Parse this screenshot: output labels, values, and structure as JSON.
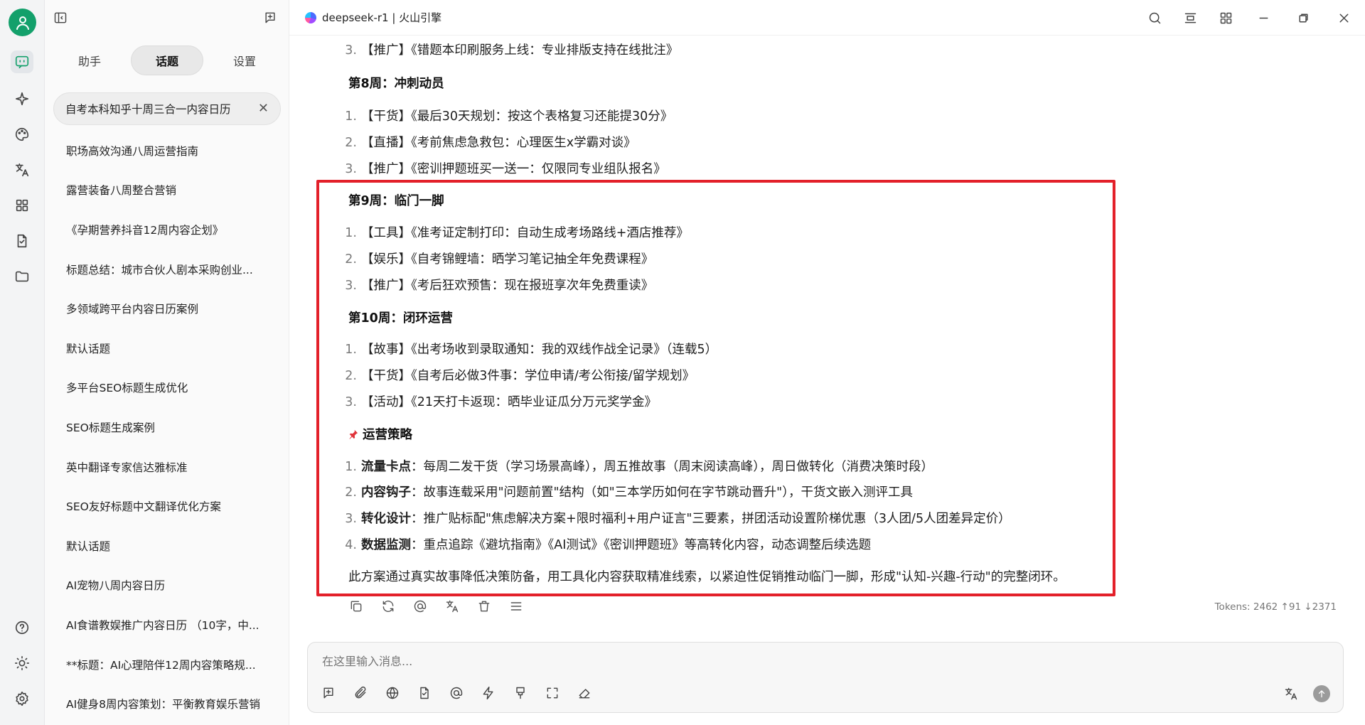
{
  "app": {
    "title": "deepseek-r1 | 火山引擎"
  },
  "panel": {
    "tabs": [
      "助手",
      "话题",
      "设置"
    ],
    "active_tab": 1,
    "topics": [
      "自考本科知乎十周三合一内容日历",
      "职场高效沟通八周运营指南",
      "露营装备八周整合营销",
      "《孕期营养抖音12周内容企划》",
      "标题总结：城市合伙人剧本采购创业...",
      "多领域跨平台内容日历案例",
      "默认话题",
      "多平台SEO标题生成优化",
      "SEO标题生成案例",
      "英中翻译专家信达雅标准",
      "SEO友好标题中文翻译优化方案",
      "默认话题",
      "AI宠物八周内容日历",
      "AI食谱教娱推广内容日历 （10字，中...",
      "**标题：AI心理陪伴12周内容策略规...",
      "AI健身8周内容策划：平衡教育娱乐营销"
    ]
  },
  "message": {
    "prev_item": {
      "num": "3.",
      "text": "【推广】《错题本印刷服务上线：专业排版支持在线批注》"
    },
    "week8": {
      "title": "第8周：冲刺动员",
      "items": [
        {
          "num": "1.",
          "text": "【干货】《最后30天规划：按这个表格复习还能提30分》"
        },
        {
          "num": "2.",
          "text": "【直播】《考前焦虑急救包：心理医生x学霸对谈》"
        },
        {
          "num": "3.",
          "text": "【推广】《密训押题班买一送一：仅限同专业组队报名》"
        }
      ]
    },
    "week9": {
      "title": "第9周：临门一脚",
      "items": [
        {
          "num": "1.",
          "text": "【工具】《准考证定制打印：自动生成考场路线+酒店推荐》"
        },
        {
          "num": "2.",
          "text": "【娱乐】《自考锦鲤墙：晒学习笔记抽全年免费课程》"
        },
        {
          "num": "3.",
          "text": "【推广】《考后狂欢预售：现在报班享次年免费重读》"
        }
      ]
    },
    "week10": {
      "title": "第10周：闭环运营",
      "items": [
        {
          "num": "1.",
          "text": "【故事】《出考场收到录取通知：我的双线作战全记录》（连载5）"
        },
        {
          "num": "2.",
          "text": "【干货】《自考后必做3件事：学位申请/考公衔接/留学规划》"
        },
        {
          "num": "3.",
          "text": "【活动】《21天打卡返现：晒毕业证瓜分万元奖学金》"
        }
      ]
    },
    "strategy": {
      "title": "运营策略",
      "items": [
        {
          "num": "1.",
          "label": "流量卡点",
          "text": "：每周二发干货（学习场景高峰），周五推故事（周末阅读高峰），周日做转化（消费决策时段）"
        },
        {
          "num": "2.",
          "label": "内容钩子",
          "text": "：故事连载采用\"问题前置\"结构（如\"三本学历如何在字节跳动晋升\"），干货文嵌入测评工具"
        },
        {
          "num": "3.",
          "label": "转化设计",
          "text": "：推广贴标配\"焦虑解决方案+限时福利+用户证言\"三要素，拼团活动设置阶梯优惠（3人团/5人团差异定价）"
        },
        {
          "num": "4.",
          "label": "数据监测",
          "text": "：重点追踪《避坑指南》《AI测试》《密训押题班》等高转化内容，动态调整后续选题"
        }
      ]
    },
    "summary": "此方案通过真实故事降低决策防备，用工具化内容获取精准线索，以紧迫性促销推动临门一脚，形成\"认知-兴趣-行动\"的完整闭环。",
    "tokens": "Tokens: 2462 ↑91 ↓2371"
  },
  "input": {
    "placeholder": "在这里输入消息..."
  },
  "colors": {
    "accent": "#13a06b",
    "highlight_border": "#e3202a"
  }
}
